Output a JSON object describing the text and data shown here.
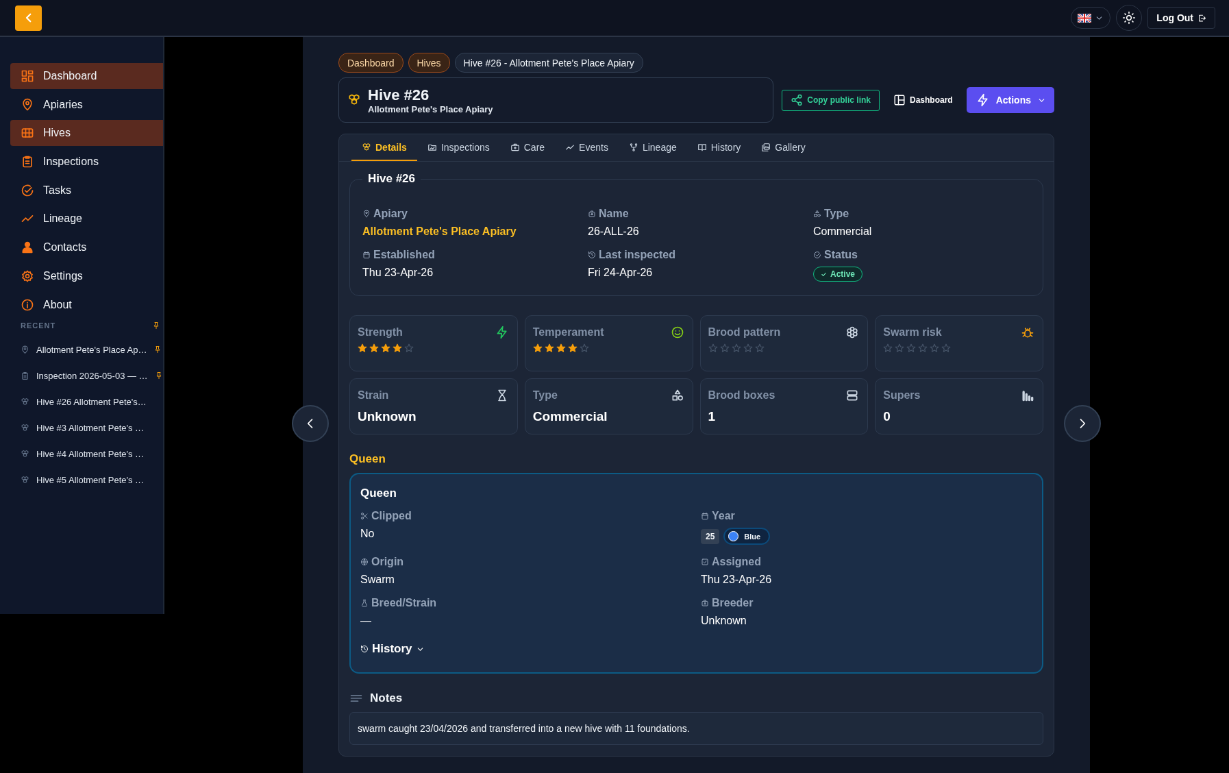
{
  "topbar": {
    "logout": "Log Out"
  },
  "sidebar": {
    "items": [
      {
        "label": "Dashboard",
        "selected": true
      },
      {
        "label": "Apiaries",
        "selected": false
      },
      {
        "label": "Hives",
        "selected": true
      },
      {
        "label": "Inspections",
        "selected": false
      },
      {
        "label": "Tasks",
        "selected": false
      },
      {
        "label": "Lineage",
        "selected": false
      },
      {
        "label": "Contacts",
        "selected": false
      },
      {
        "label": "Settings",
        "selected": false
      },
      {
        "label": "About",
        "selected": false
      }
    ],
    "recent_label": "RECENT",
    "recent_pinned": true,
    "recent": [
      {
        "label": "Allotment Pete's Place Ap…",
        "kind": "apiary",
        "pinned": true
      },
      {
        "label": "Inspection 2026-05-03 — …",
        "kind": "inspection",
        "pinned": true
      },
      {
        "label": "Hive #26 Allotment Pete's…",
        "kind": "hive",
        "pinned": false
      },
      {
        "label": "Hive #3 Allotment Pete's …",
        "kind": "hive",
        "pinned": false
      },
      {
        "label": "Hive #4 Allotment Pete's …",
        "kind": "hive",
        "pinned": false
      },
      {
        "label": "Hive #5 Allotment Pete's …",
        "kind": "hive",
        "pinned": false
      }
    ]
  },
  "breadcrumbs": [
    {
      "label": "Dashboard",
      "kind": "link"
    },
    {
      "label": "Hives",
      "kind": "link"
    },
    {
      "label": "Hive #26 - Allotment Pete's Place Apiary",
      "kind": "current"
    }
  ],
  "header": {
    "title": "Hive #26",
    "subtitle": "Allotment Pete's Place Apiary",
    "copy_link": "Copy public link",
    "dashboard": "Dashboard",
    "actions": "Actions"
  },
  "tabs": [
    {
      "label": "Details",
      "selected": true
    },
    {
      "label": "Inspections",
      "selected": false
    },
    {
      "label": "Care",
      "selected": false
    },
    {
      "label": "Events",
      "selected": false
    },
    {
      "label": "Lineage",
      "selected": false
    },
    {
      "label": "History",
      "selected": false
    },
    {
      "label": "Gallery",
      "selected": false
    }
  ],
  "details": {
    "legend": "Hive #26",
    "fields": [
      {
        "label": "Apiary",
        "value": "Allotment Pete's Place Apiary",
        "kind": "link"
      },
      {
        "label": "Name",
        "value": "26-ALL-26",
        "kind": "text"
      },
      {
        "label": "Type",
        "value": "Commercial",
        "kind": "text"
      },
      {
        "label": "Established",
        "value": "Thu 23-Apr-26",
        "kind": "text"
      },
      {
        "label": "Last inspected",
        "value": "Fri 24-Apr-26",
        "kind": "text"
      },
      {
        "label": "Status",
        "value": "Active",
        "kind": "badge"
      }
    ]
  },
  "stats": [
    {
      "label": "Strength",
      "kind": "rating",
      "stars": 4
    },
    {
      "label": "Temperament",
      "kind": "rating",
      "stars": 4
    },
    {
      "label": "Brood pattern",
      "kind": "rating",
      "stars": 0
    },
    {
      "label": "Swarm risk",
      "kind": "risk",
      "stars": 0
    },
    {
      "label": "Strain",
      "kind": "value",
      "value": "Unknown"
    },
    {
      "label": "Type",
      "kind": "value",
      "value": "Commercial"
    },
    {
      "label": "Brood boxes",
      "kind": "value",
      "value": "1"
    },
    {
      "label": "Supers",
      "kind": "value",
      "value": "0"
    }
  ],
  "queen": {
    "heading": "Queen",
    "title": "Queen",
    "fields": [
      {
        "label": "Clipped",
        "kind": "text",
        "value": "No"
      },
      {
        "label": "Year",
        "kind": "year",
        "value": "25",
        "color_label": "Blue",
        "color": "#3b82f6"
      },
      {
        "label": "Origin",
        "kind": "text",
        "value": "Swarm"
      },
      {
        "label": "Assigned",
        "kind": "text",
        "value": "Thu 23-Apr-26"
      },
      {
        "label": "Breed/Strain",
        "kind": "text",
        "value": "—"
      },
      {
        "label": "Breeder",
        "kind": "text",
        "value": "Unknown"
      }
    ],
    "history": {
      "label": "History",
      "expanded": false
    }
  },
  "notes": {
    "heading": "Notes",
    "text": "swarm caught 23/04/2026 and transferred into a new hive with 11 foundations."
  }
}
